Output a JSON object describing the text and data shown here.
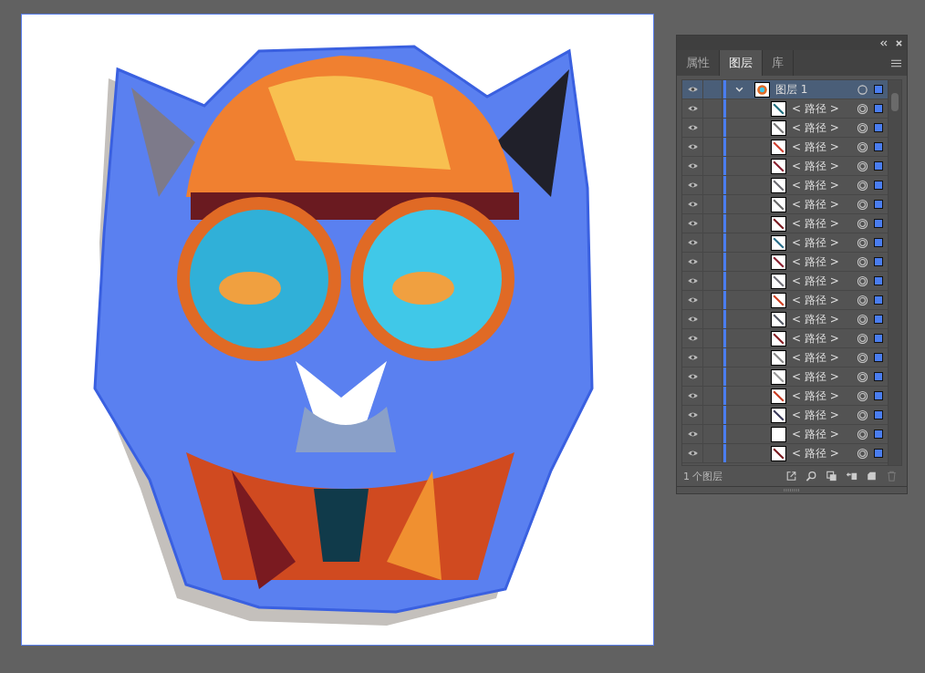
{
  "panel": {
    "tabs": [
      {
        "label": "属性",
        "selected": false
      },
      {
        "label": "图层",
        "selected": true
      },
      {
        "label": "库",
        "selected": false
      }
    ],
    "layers": [
      {
        "name": "图层 1",
        "kind": "layer",
        "visible": true,
        "selected": true,
        "expanded": true,
        "children": [
          {
            "name": "< 路径 >",
            "kind": "path",
            "visible": true,
            "selected": false,
            "color": "#1f6f7f"
          },
          {
            "name": "< 路径 >",
            "kind": "path",
            "visible": true,
            "selected": false,
            "color": "#777777"
          },
          {
            "name": "< 路径 >",
            "kind": "path",
            "visible": true,
            "selected": false,
            "color": "#d04030"
          },
          {
            "name": "< 路径 >",
            "kind": "path",
            "visible": true,
            "selected": false,
            "color": "#8a2030"
          },
          {
            "name": "< 路径 >",
            "kind": "path",
            "visible": true,
            "selected": false,
            "color": "#6a6a70"
          },
          {
            "name": "< 路径 >",
            "kind": "path",
            "visible": true,
            "selected": false,
            "color": "#666666"
          },
          {
            "name": "< 路径 >",
            "kind": "path",
            "visible": true,
            "selected": false,
            "color": "#7a1a20"
          },
          {
            "name": "< 路径 >",
            "kind": "path",
            "visible": true,
            "selected": false,
            "color": "#2a6f8a"
          },
          {
            "name": "< 路径 >",
            "kind": "path",
            "visible": true,
            "selected": false,
            "color": "#8a2030"
          },
          {
            "name": "< 路径 >",
            "kind": "path",
            "visible": true,
            "selected": false,
            "color": "#707078"
          },
          {
            "name": "< 路径 >",
            "kind": "path",
            "visible": true,
            "selected": false,
            "color": "#d04020"
          },
          {
            "name": "< 路径 >",
            "kind": "path",
            "visible": true,
            "selected": false,
            "color": "#555a66"
          },
          {
            "name": "< 路径 >",
            "kind": "path",
            "visible": true,
            "selected": false,
            "color": "#8a1f25"
          },
          {
            "name": "< 路径 >",
            "kind": "path",
            "visible": true,
            "selected": false,
            "color": "#888888"
          },
          {
            "name": "< 路径 >",
            "kind": "path",
            "visible": true,
            "selected": false,
            "color": "#999999"
          },
          {
            "name": "< 路径 >",
            "kind": "path",
            "visible": true,
            "selected": false,
            "color": "#c83a20"
          },
          {
            "name": "< 路径 >",
            "kind": "path",
            "visible": true,
            "selected": false,
            "color": "#3a3a5a"
          },
          {
            "name": "< 路径 >",
            "kind": "path",
            "visible": true,
            "selected": false,
            "color": "#ffffff"
          },
          {
            "name": "< 路径 >",
            "kind": "path",
            "visible": true,
            "selected": false,
            "color": "#7a1a20"
          }
        ]
      }
    ],
    "layer_count": "1 个图层"
  }
}
